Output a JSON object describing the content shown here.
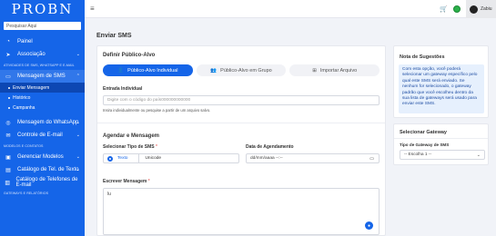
{
  "sidebar": {
    "logo": "PROBN",
    "search_placeholder": "Pesquisar Aqui",
    "items": [
      {
        "label": "Painel",
        "icon": "speedometer-icon"
      },
      {
        "label": "Associação",
        "icon": "send-icon"
      }
    ],
    "section_sms": "ATIVIDADES DE SMS, WHATSAPP E E-MAIL",
    "sms_item": {
      "label": "Mensagem de SMS",
      "icon": "chat-icon"
    },
    "sms_sub": [
      "Enviar Mensagem",
      "Histórico",
      "Campanha"
    ],
    "items2": [
      {
        "label": "Mensagem do WhatsApp",
        "icon": "whatsapp-icon"
      },
      {
        "label": "Controle de E-mail",
        "icon": "email-icon"
      }
    ],
    "section_models": "MODELOS E CONTATOS",
    "items3": [
      {
        "label": "Gerenciar Modelos",
        "icon": "template-icon"
      },
      {
        "label": "Catálogo de Tel. de Texto",
        "icon": "catalog-icon"
      },
      {
        "label": "Catálogo de Telefones de E-mail",
        "icon": "phonebook-icon"
      }
    ],
    "section_gateways": "GATEWAYS E RELATÓRIOS"
  },
  "topbar": {
    "user_name": "Zabiu"
  },
  "page": {
    "title": "Enviar SMS"
  },
  "target": {
    "title": "Definir Público-Alvo",
    "tabs": [
      "Público-Alvo Individual",
      "Público-Alvo em Grupo",
      "Importar Arquivo"
    ],
    "individual_label": "Entrada Individual",
    "individual_placeholder": "Digite com o código do país000000000000",
    "individual_help": "Insira individualmente ou pesquise a partir de um arquivo salvo."
  },
  "schedule": {
    "title": "Agendar e Mensagem",
    "type_label": "Selecionar Tipo de SMS",
    "type_options": [
      "Texto",
      "Unicode"
    ],
    "date_label": "Data de Agendamento",
    "date_placeholder": "dd/mm/aaaa --:--",
    "message_label": "Escrever Mensagem",
    "message_value": "lu"
  },
  "note": {
    "title": "Nota de Sugestões",
    "body": "Com esta opção, você poderá selecionar um gateway específico pelo qual este SMS será enviado. Se nenhum for selecionado, o gateway padrão que você escolheu dentro da sua lista de gateways será usado para enviar este SMS."
  },
  "gateway": {
    "title": "Selecionar Gateway",
    "type_label": "Tipo de Gateway de SMS",
    "selected": "-- Escolha 1 --"
  },
  "colors": {
    "primary": "#1565e8",
    "background": "#f1f3f8",
    "note_bg": "#e6f0fd"
  }
}
